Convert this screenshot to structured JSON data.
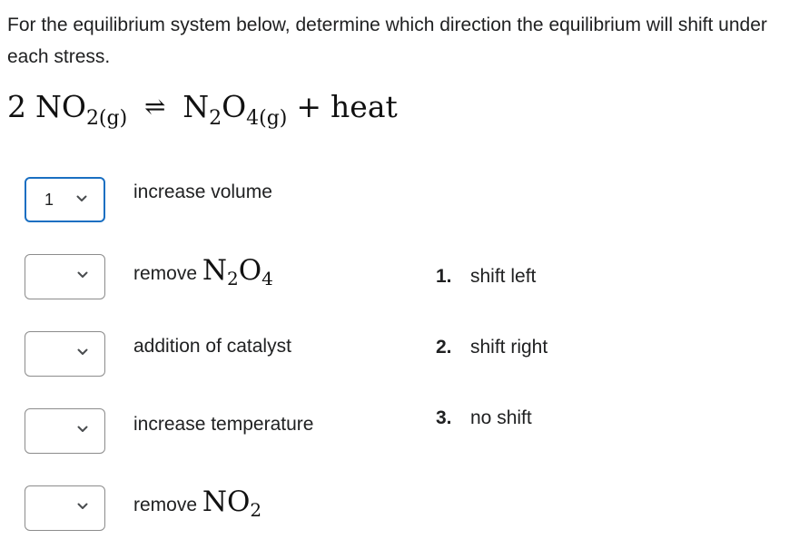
{
  "question": {
    "text": "For the equilibrium system below, determine which direction the equilibrium will shift under each stress."
  },
  "equation": {
    "coefficient": "2",
    "reactant": "NO",
    "reactant_sub": "2(g)",
    "arrow": "⇌",
    "product": "N",
    "product_sub1": "2",
    "product_mid": "O",
    "product_sub2": "4(g)",
    "plus": "+",
    "heat": "heat"
  },
  "stresses": [
    {
      "selected": "1",
      "label": "increase volume",
      "chem": null
    },
    {
      "selected": "",
      "label": "remove",
      "chem": {
        "a": "N",
        "a_sub": "2",
        "b": "O",
        "b_sub": "4"
      }
    },
    {
      "selected": "",
      "label": "addition of catalyst",
      "chem": null
    },
    {
      "selected": "",
      "label": "increase temperature",
      "chem": null
    },
    {
      "selected": "",
      "label": "remove",
      "chem": {
        "a": "NO",
        "a_sub": "2"
      }
    }
  ],
  "answers": [
    {
      "num": "1.",
      "text": "shift left"
    },
    {
      "num": "2.",
      "text": "shift right"
    },
    {
      "num": "3.",
      "text": "no shift"
    }
  ],
  "colors": {
    "active_border": "#1a6fc2",
    "inactive_border": "#8c8c8c",
    "text": "#202122"
  }
}
